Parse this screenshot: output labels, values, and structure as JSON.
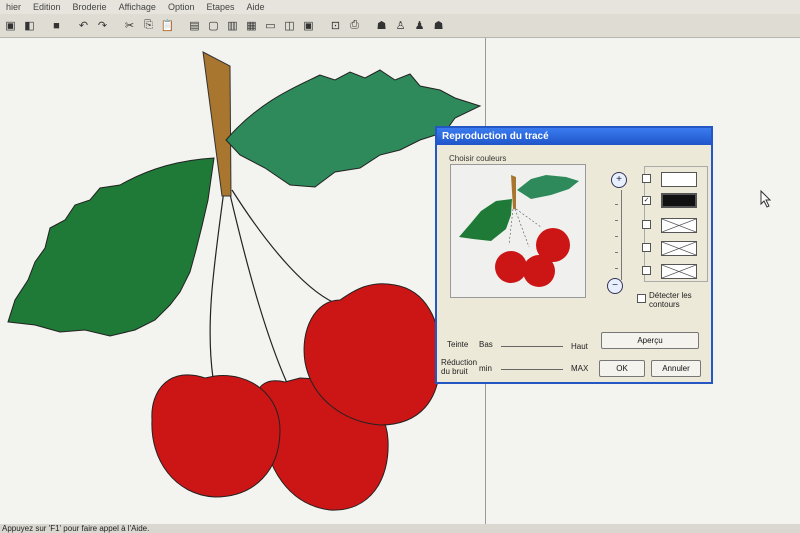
{
  "menu": [
    "hier",
    "Edition",
    "Broderie",
    "Affichage",
    "Option",
    "Etapes",
    "Aide"
  ],
  "status_text": "Appuyez sur 'F1' pour faire appel à l'Aide.",
  "dialog": {
    "title": "Reproduction du tracé",
    "choose_colors": "Choisir couleurs",
    "detect_contours": "Détecter les contours",
    "tint_label": "Teinte",
    "tint_low": "Bas",
    "tint_high": "Haut",
    "noise_label": "Réduction du bruit",
    "noise_min": "min",
    "noise_max": "MAX",
    "preview_button": "Aperçu",
    "ok_button": "OK",
    "cancel_button": "Annuler",
    "checkboxes": [
      false,
      true,
      false,
      false,
      false
    ]
  },
  "colors": {
    "leaf_dark": "#1e7a36",
    "leaf_light": "#2e8a5a",
    "stem": "#a8762e",
    "cherry": "#cc1515",
    "title_blue": "#2456c4"
  }
}
